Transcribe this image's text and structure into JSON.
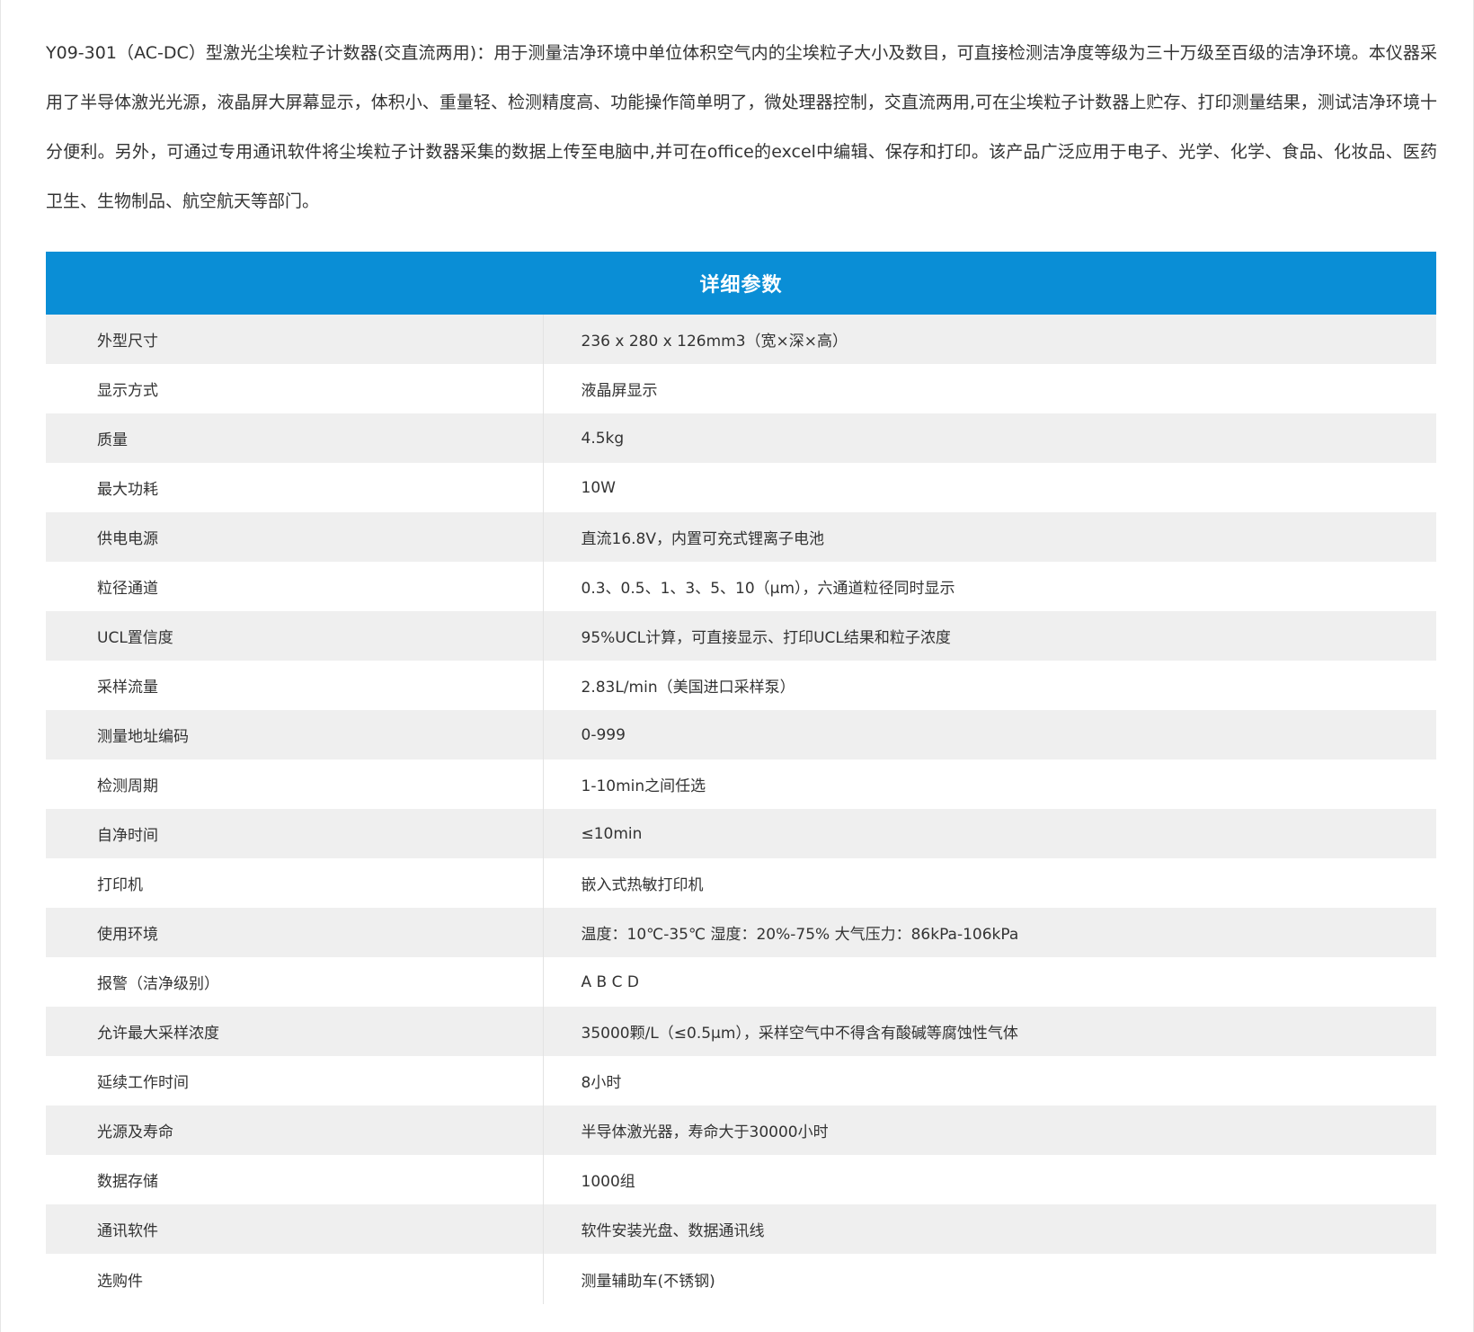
{
  "intro_text": "Y09-301（AC-DC）型激光尘埃粒子计数器(交直流两用)：用于测量洁净环境中单位体积空气内的尘埃粒子大小及数目，可直接检测洁净度等级为三十万级至百级的洁净环境。本仪器采用了半导体激光光源，液晶屏大屏幕显示，体积小、重量轻、检测精度高、功能操作简单明了，微处理器控制，交直流两用,可在尘埃粒子计数器上贮存、打印测量结果，测试洁净环境十分便利。另外，可通过专用通讯软件将尘埃粒子计数器采集的数据上传至电脑中,并可在office的excel中编辑、保存和打印。该产品广泛应用于电子、光学、化学、食品、化妆品、医药卫生、生物制品、航空航天等部门。",
  "table": {
    "header": "详细参数",
    "header_color": "#0a8ed6",
    "stripe_color": "#efefef",
    "rows": [
      {
        "label": "外型尺寸",
        "value": "236 x 280 x 126mm3（宽×深×高）"
      },
      {
        "label": "显示方式",
        "value": "液晶屏显示"
      },
      {
        "label": "质量",
        "value": "4.5kg"
      },
      {
        "label": "最大功耗",
        "value": "10W"
      },
      {
        "label": "供电电源",
        "value": "直流16.8V，内置可充式锂离子电池"
      },
      {
        "label": "粒径通道",
        "value": "0.3、0.5、1、3、5、10（μm），六通道粒径同时显示"
      },
      {
        "label": "UCL置信度",
        "value": "95%UCL计算，可直接显示、打印UCL结果和粒子浓度"
      },
      {
        "label": "采样流量",
        "value": "2.83L/min（美国进口采样泵）"
      },
      {
        "label": "测量地址编码",
        "value": "0-999"
      },
      {
        "label": "检测周期",
        "value": "1-10min之间任选"
      },
      {
        "label": "自净时间",
        "value": "≤10min"
      },
      {
        "label": "打印机",
        "value": "嵌入式热敏打印机"
      },
      {
        "label": "使用环境",
        "value": "温度：10℃-35℃ 湿度：20%-75% 大气压力：86kPa-106kPa"
      },
      {
        "label": "报警（洁净级别）",
        "value": "A B C D"
      },
      {
        "label": "允许最大采样浓度",
        "value": "35000颗/L（≤0.5μm），采样空气中不得含有酸碱等腐蚀性气体"
      },
      {
        "label": "延续工作时间",
        "value": "8小时"
      },
      {
        "label": "光源及寿命",
        "value": "半导体激光器，寿命大于30000小时"
      },
      {
        "label": "数据存储",
        "value": "1000组"
      },
      {
        "label": "通讯软件",
        "value": "软件安装光盘、数据通讯线"
      },
      {
        "label": "选购件",
        "value": "测量辅助车(不锈钢)"
      }
    ]
  }
}
